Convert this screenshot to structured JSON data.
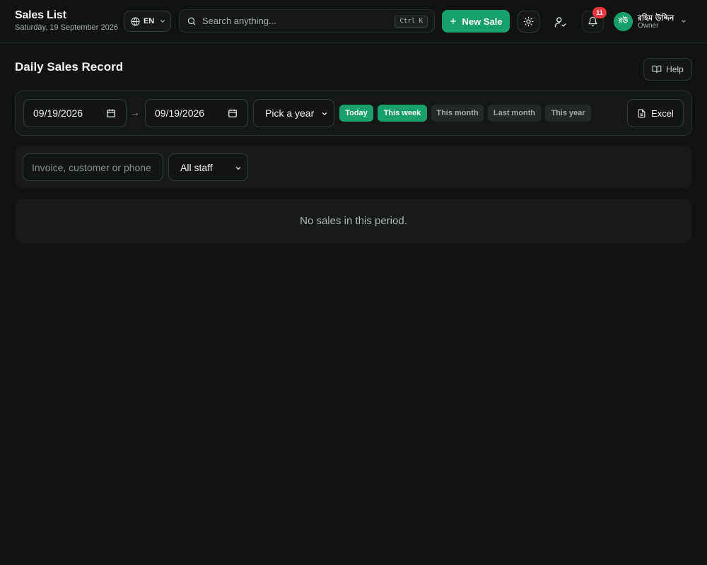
{
  "header": {
    "title": "Sales List",
    "date": "Saturday, 19 September 2026",
    "language": "EN",
    "search_placeholder": "Search anything...",
    "search_shortcut": "Ctrl K",
    "new_sale_label": "New Sale",
    "notification_count": "11",
    "user": {
      "initials": "রউ",
      "name": "রহিম উদ্দিন",
      "role": "Owner"
    }
  },
  "page": {
    "title": "Daily Sales Record",
    "help_label": "Help"
  },
  "filters": {
    "date_from": "09/19/2026",
    "date_to": "09/19/2026",
    "range_separator": "→",
    "year_select_value": "Pick a year",
    "quick_ranges": [
      {
        "label": "Today",
        "active": true
      },
      {
        "label": "This week",
        "active": true
      },
      {
        "label": "This month",
        "active": false
      },
      {
        "label": "Last month",
        "active": false
      },
      {
        "label": "This year",
        "active": false
      }
    ],
    "export_label": "Excel"
  },
  "search": {
    "placeholder": "Invoice, customer or phone",
    "staff_select_value": "All staff"
  },
  "results": {
    "empty_message": "No sales in this period."
  },
  "colors": {
    "accent": "#17a06b",
    "background": "#111312",
    "badge": "#e5363f"
  }
}
